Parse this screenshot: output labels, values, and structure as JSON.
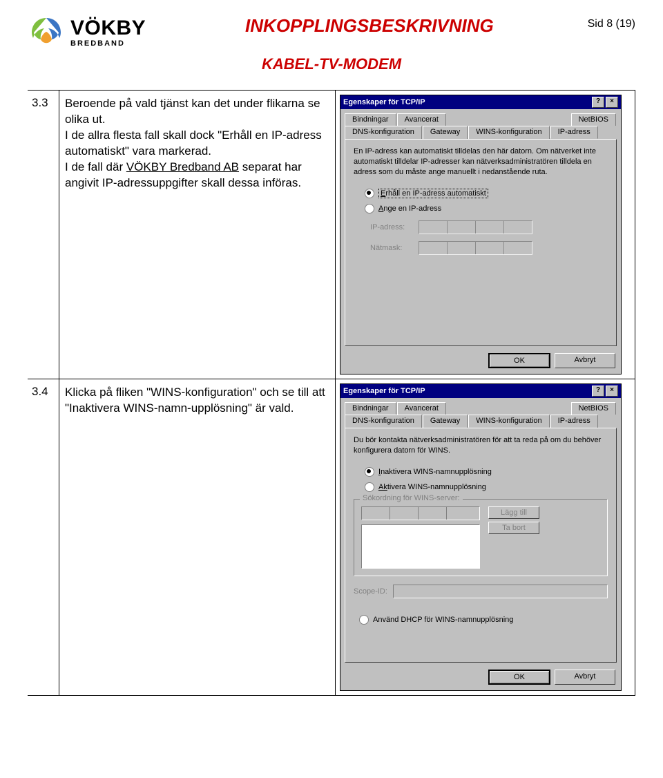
{
  "header": {
    "logo_main": "VÖKBY",
    "logo_sub": "BREDBAND",
    "title": "INKOPPLINGSBESKRIVNING",
    "page_label": "Sid 8 (19)",
    "subtitle": "KABEL-TV-MODEM"
  },
  "rows": [
    {
      "num": "3.3",
      "text_parts": {
        "p1": "Beroende på vald tjänst kan det under flikarna se olika ut.",
        "p2a": "I de allra flesta fall skall dock \"Erhåll en IP-adress automatiskt\" vara markerad.",
        "p2b": "I de fall där ",
        "p2_u": "VÖKBY Bredband AB",
        "p2c": " separat har angivit IP-adressuppgifter skall dessa införas."
      }
    },
    {
      "num": "3.4",
      "text_parts": {
        "p1": "Klicka på fliken \"WINS-konfiguration\" och se till att \"Inaktivera WINS-namn-upplösning\" är vald."
      }
    }
  ],
  "dialog1": {
    "title": "Egenskaper för TCP/IP",
    "help_btn": "?",
    "close_btn": "×",
    "tabs_row1": [
      "Bindningar",
      "Avancerat",
      "NetBIOS"
    ],
    "tabs_row2": [
      "DNS-konfiguration",
      "Gateway",
      "WINS-konfiguration",
      "IP-adress"
    ],
    "active_tab": "IP-adress",
    "desc": "En IP-adress kan automatiskt tilldelas den här datorn. Om nätverket inte automatiskt tilldelar IP-adresser kan nätverksadministratören tilldela en adress som du måste ange manuellt i nedanstående ruta.",
    "radio_auto_prefix": "E",
    "radio_auto_rest": "rhåll en IP-adress automatiskt",
    "radio_manual_prefix": "A",
    "radio_manual_rest": "nge en IP-adress",
    "label_ip_prefix": "I",
    "label_ip_rest": "P-adress:",
    "label_mask_prefix": "N",
    "label_mask_rest": "ätmask:",
    "ok": "OK",
    "cancel": "Avbryt"
  },
  "dialog2": {
    "title": "Egenskaper för TCP/IP",
    "help_btn": "?",
    "close_btn": "×",
    "tabs_row1": [
      "Bindningar",
      "Avancerat",
      "NetBIOS"
    ],
    "tabs_row2": [
      "DNS-konfiguration",
      "Gateway",
      "WINS-konfiguration",
      "IP-adress"
    ],
    "active_tab": "WINS-konfiguration",
    "desc": "Du bör kontakta nätverksadministratören för att ta reda på om du behöver konfigurera datorn för WINS.",
    "radio_disable_prefix": "I",
    "radio_disable_rest": "naktivera WINS-namnupplösning",
    "radio_enable_prefix": "Ak",
    "radio_enable_rest": "tivera WINS-namnupplösning",
    "group_title_prefix": "S",
    "group_title_rest": "ökordning för WINS-server:",
    "btn_add_prefix": "L",
    "btn_add_rest": "ägg till",
    "btn_remove_prefix": "T",
    "btn_remove_rest": "a bort",
    "scope_label": "Scope-ID:",
    "dhcp_checkbox": "Använd DHCP för WINS-namnupplösning",
    "ok": "OK",
    "cancel": "Avbryt"
  }
}
